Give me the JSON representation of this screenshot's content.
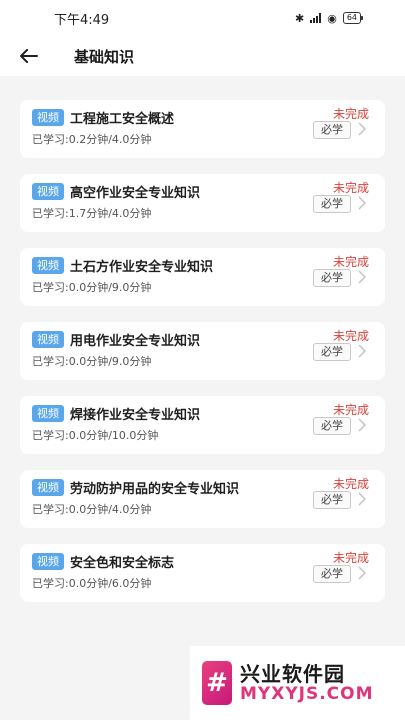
{
  "status_bar": {
    "time": "下午4:49",
    "bluetooth": "✱",
    "wifi": "◉",
    "battery": "64"
  },
  "header": {
    "back_icon": "arrow-left-icon",
    "title": "基础知识"
  },
  "courses": [
    {
      "tag": "视频",
      "title": "工程施工安全概述",
      "progress": "已学习:0.2分钟/4.0分钟",
      "status": "未完成",
      "badge": "必学"
    },
    {
      "tag": "视频",
      "title": "高空作业安全专业知识",
      "progress": "已学习:1.7分钟/4.0分钟",
      "status": "未完成",
      "badge": "必学"
    },
    {
      "tag": "视频",
      "title": "土石方作业安全专业知识",
      "progress": "已学习:0.0分钟/9.0分钟",
      "status": "未完成",
      "badge": "必学"
    },
    {
      "tag": "视频",
      "title": "用电作业安全专业知识",
      "progress": "已学习:0.0分钟/9.0分钟",
      "status": "未完成",
      "badge": "必学"
    },
    {
      "tag": "视频",
      "title": "焊接作业安全专业知识",
      "progress": "已学习:0.0分钟/10.0分钟",
      "status": "未完成",
      "badge": "必学"
    },
    {
      "tag": "视频",
      "title": "劳动防护用品的安全专业知识",
      "progress": "已学习:0.0分钟/4.0分钟",
      "status": "未完成",
      "badge": "必学"
    },
    {
      "tag": "视频",
      "title": "安全色和安全标志",
      "progress": "已学习:0.0分钟/6.0分钟",
      "status": "未完成",
      "badge": "必学"
    }
  ],
  "watermark": {
    "logo_char": "#",
    "name": "兴业软件园",
    "url": "MYXYJS.COM"
  },
  "colors": {
    "tag_bg": "#5aa6ea",
    "status_red": "#d9433a",
    "background": "#f4f4f5",
    "watermark_pink": "#e0357c"
  }
}
